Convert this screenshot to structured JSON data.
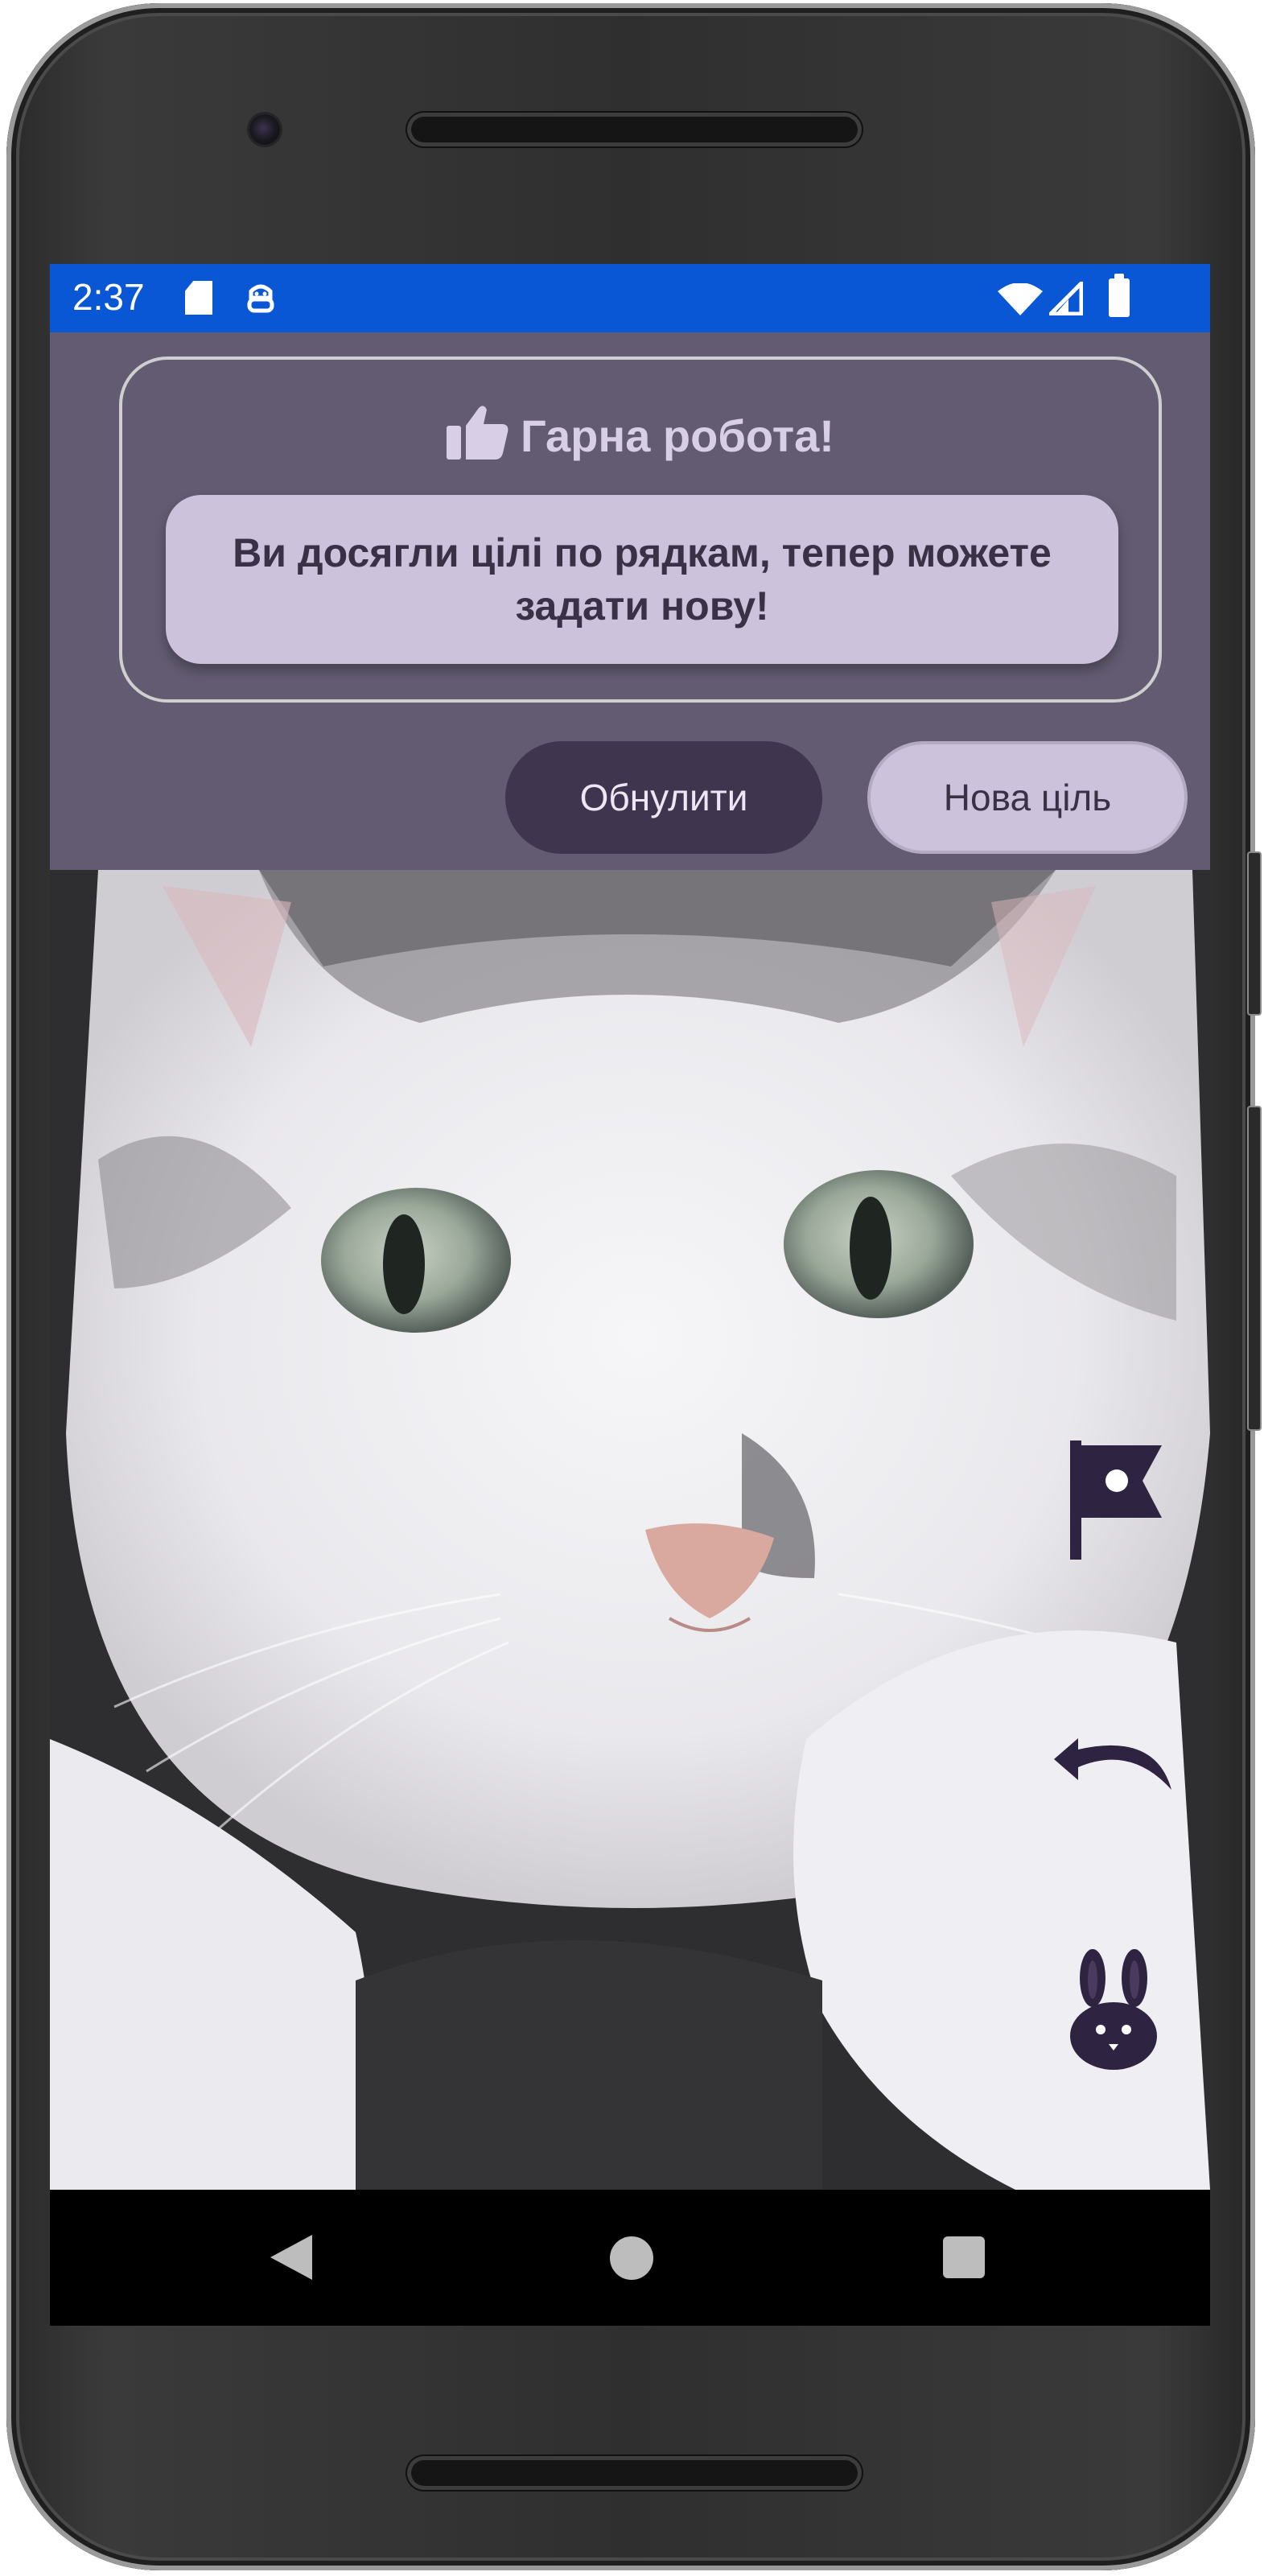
{
  "status_bar": {
    "time": "2:37",
    "icons": [
      "sd-card-icon",
      "robot-icon",
      "wifi-icon",
      "signal-icon",
      "battery-icon"
    ],
    "background_color": "#0a57d6"
  },
  "dialog": {
    "title": "Гарна робота!",
    "title_icon": "thumbs-up-icon",
    "message": "Ви досягли цілі по рядкам, тепер можете задати нову!",
    "buttons": {
      "reset_label": "Обнулити",
      "new_goal_label": "Нова ціль"
    },
    "colors": {
      "surface": "#625b71",
      "message_bg": "#ccc2dc",
      "reset_bg": "#3f354e"
    }
  },
  "content": {
    "image": "cat-photo",
    "side_actions": [
      "flag-icon",
      "undo-icon",
      "rabbit-icon"
    ]
  },
  "nav_bar": {
    "icons": [
      "back-icon",
      "home-icon",
      "recents-icon"
    ]
  }
}
